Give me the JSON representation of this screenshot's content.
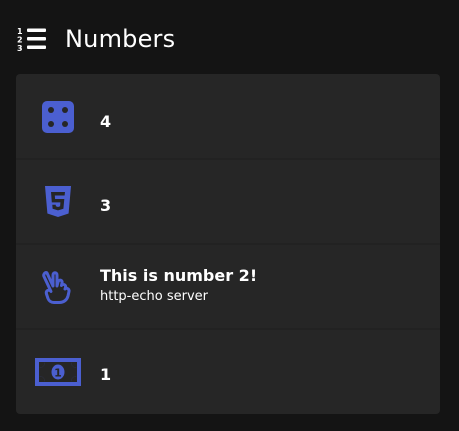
{
  "header": {
    "icon": "list-ol-icon",
    "title": "Numbers"
  },
  "accent_color": "#4b5fd0",
  "items": [
    {
      "icon": "dice-four-icon",
      "value": "4"
    },
    {
      "icon": "html5-icon",
      "value": "3"
    },
    {
      "icon": "hand-peace-icon",
      "title": "This is number 2!",
      "subtitle": "http-echo server"
    },
    {
      "icon": "money-bill-icon",
      "value": "1"
    }
  ]
}
